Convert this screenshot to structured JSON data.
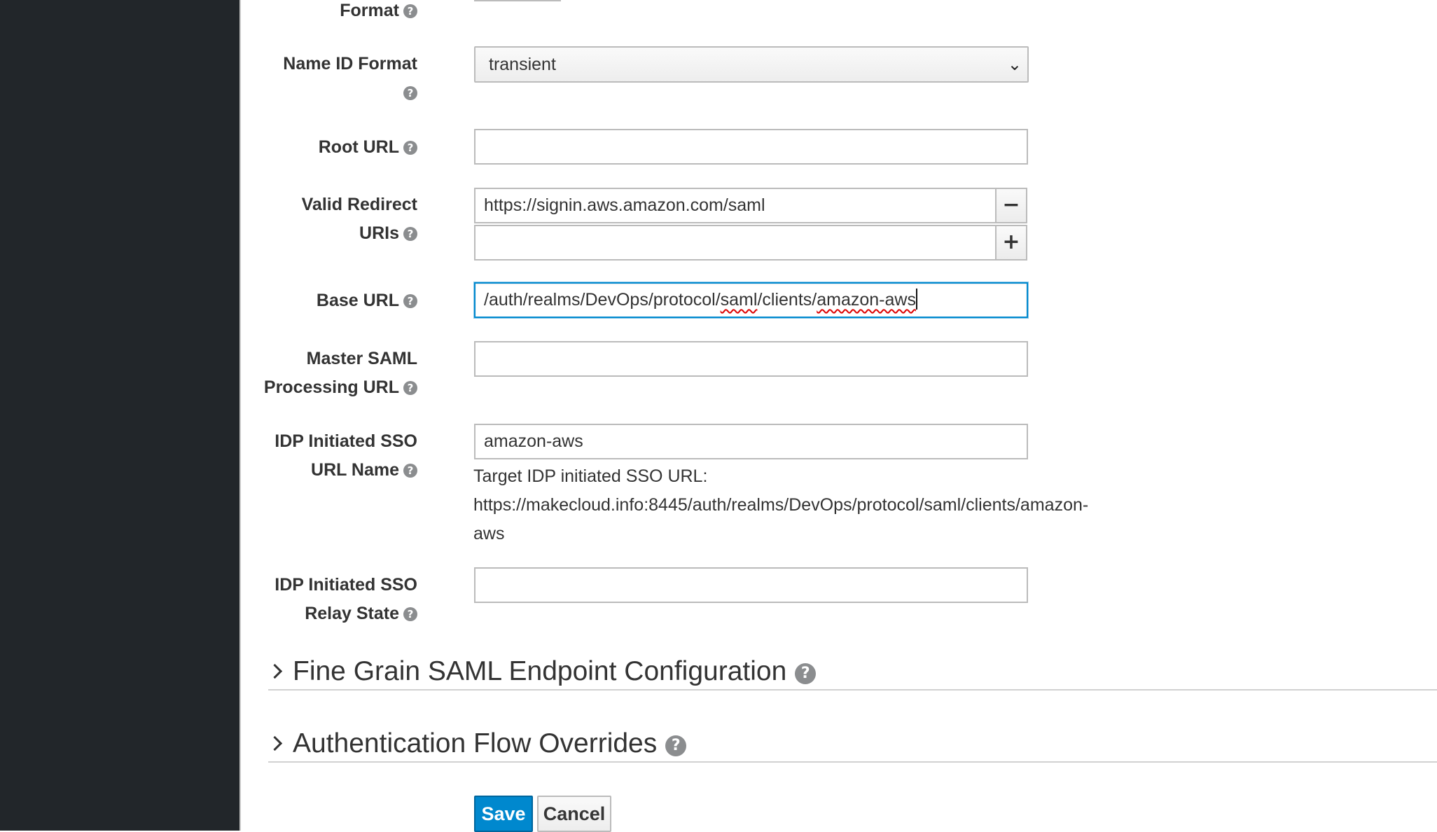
{
  "form": {
    "format_label": "Format",
    "name_id_format": {
      "label": "Name ID Format",
      "value": "transient"
    },
    "root_url": {
      "label": "Root URL",
      "value": ""
    },
    "valid_redirect_uris": {
      "label_line1": "Valid Redirect",
      "label_line2": "URIs",
      "values": [
        "https://signin.aws.amazon.com/saml",
        ""
      ],
      "remove_glyph": "−",
      "add_glyph": "+"
    },
    "base_url": {
      "label": "Base URL",
      "value_parts": [
        "/auth/realms/DevOps/protocol/",
        "saml",
        "/clients/",
        "amazon-aws"
      ]
    },
    "master_saml_processing_url": {
      "label_line1": "Master SAML",
      "label_line2": "Processing URL",
      "value": ""
    },
    "idp_initiated_sso_url_name": {
      "label_line1": "IDP Initiated SSO",
      "label_line2": "URL Name",
      "value": "amazon-aws",
      "help_line1": "Target IDP initiated SSO URL:",
      "help_line2": "https://makecloud.info:8445/auth/realms/DevOps/protocol/saml/clients/amazon-",
      "help_line3": "aws"
    },
    "idp_initiated_sso_relay_state": {
      "label_line1": "IDP Initiated SSO",
      "label_line2": "Relay State",
      "value": ""
    }
  },
  "sections": {
    "fine_grain": "Fine Grain SAML Endpoint Configuration",
    "auth_flow": "Authentication Flow Overrides"
  },
  "buttons": {
    "save": "Save",
    "cancel": "Cancel"
  },
  "icons": {
    "help_glyph": "?",
    "select_chevron": "⌄"
  },
  "colors": {
    "sidebar": "#22262a",
    "primary": "#0088ce",
    "help_icon": "#8b8d8f"
  }
}
